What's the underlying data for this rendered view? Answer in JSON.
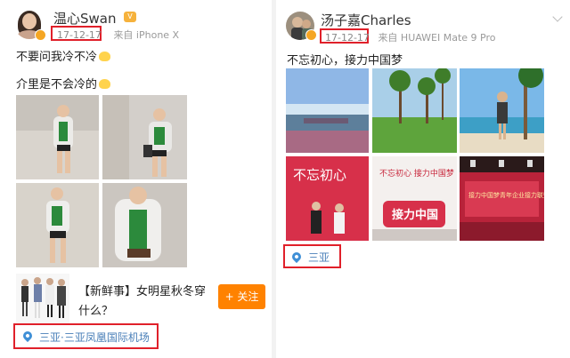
{
  "left_post": {
    "user": {
      "name": "温心Swan",
      "badge": "V"
    },
    "meta": {
      "date": "17-12-17",
      "source": "来自 iPhone X"
    },
    "text_lines": [
      "不要问我冷不冷",
      "介里是不会冷的"
    ],
    "related": {
      "title": "【新鲜事】女明星秋冬穿什么？",
      "follow_label": "+ 关注"
    },
    "location": "三亚·三亚凤凰国际机场"
  },
  "right_post": {
    "user": {
      "name": "汤子嘉Charles"
    },
    "meta": {
      "date": "17-12-17",
      "source": "来自 HUAWEI Mate 9 Pro"
    },
    "text_lines": [
      "不忘初心，接力中国梦"
    ],
    "photo_captions": [
      "不忘初心",
      "不忘初心 接力中国梦",
      "接力中国",
      "接力中国梦青年企业接力联盟会"
    ],
    "location": "三亚"
  },
  "colors": {
    "highlight_box": "#e0202a",
    "follow_button": "#ff8200",
    "location_text": "#4a7fb8"
  }
}
